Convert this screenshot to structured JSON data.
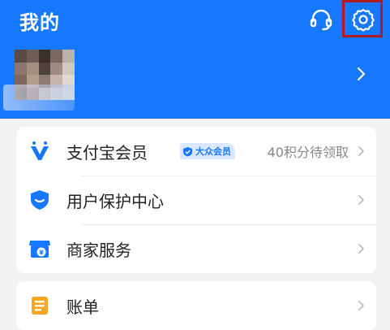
{
  "header": {
    "title": "我的",
    "bg_color": "#1677ff",
    "support_icon": "headset-icon",
    "settings_icon": "gear-icon",
    "highlight_color": "#b01b22"
  },
  "profile": {
    "avatar_icon": "avatar-pixelated",
    "chevron_icon": "chevron-right-icon"
  },
  "menu_groups": [
    {
      "items": [
        {
          "label": "支付宝会员",
          "icon": "member-badge-icon",
          "badge": "大众会员",
          "trail": "40积分待领取"
        },
        {
          "label": "用户保护中心",
          "icon": "shield-icon"
        },
        {
          "label": "商家服务",
          "icon": "shop-icon"
        }
      ]
    },
    {
      "items": [
        {
          "label": "账单",
          "icon": "bill-icon"
        }
      ]
    }
  ]
}
